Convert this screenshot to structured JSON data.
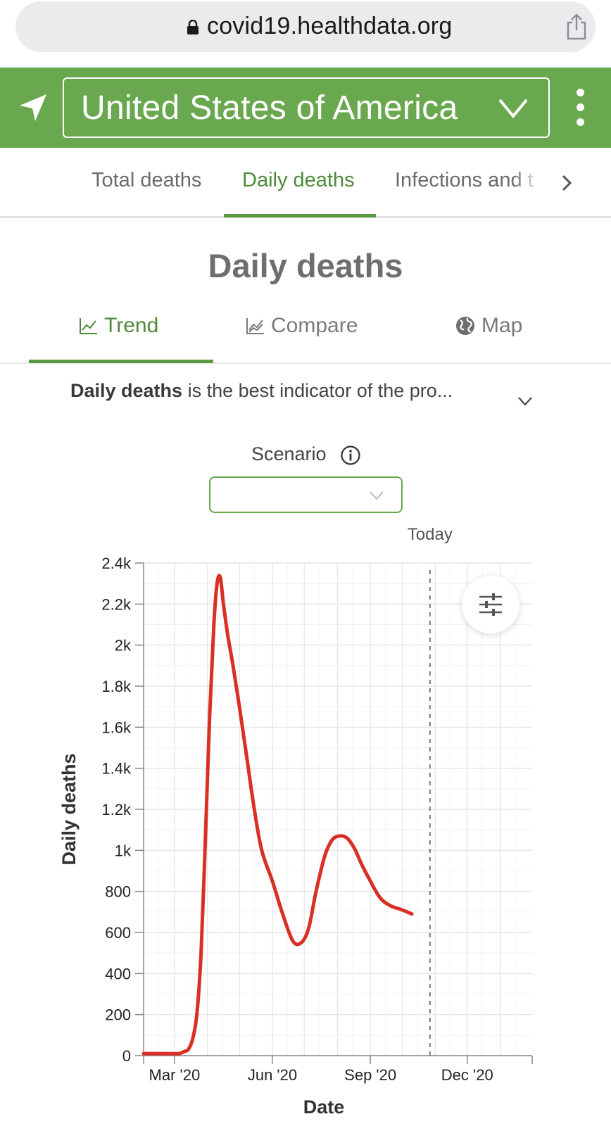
{
  "browser": {
    "url": "covid19.healthdata.org"
  },
  "header": {
    "country": "United States of America"
  },
  "top_tabs": [
    {
      "label": "Total deaths",
      "active": false
    },
    {
      "label": "Daily deaths",
      "active": true
    },
    {
      "label": "Infections and t",
      "active": false
    }
  ],
  "page_title": "Daily deaths",
  "sub_tabs": [
    {
      "label": "Trend",
      "icon": "trend-icon",
      "active": true
    },
    {
      "label": "Compare",
      "icon": "compare-icon",
      "active": false
    },
    {
      "label": "Map",
      "icon": "globe-icon",
      "active": false
    }
  ],
  "description": {
    "bold": "Daily deaths",
    "rest": " is the best indicator of the pro..."
  },
  "scenario": {
    "label": "Scenario",
    "value": ""
  },
  "colors": {
    "brand_green": "#6aa84f",
    "active_tab": "#4f8a3c",
    "line": "#d93025"
  },
  "chart_data": {
    "type": "line",
    "xlabel": "Date",
    "ylabel": "Daily deaths",
    "ylim": [
      0,
      2400
    ],
    "xlim": [
      "2020-02-01",
      "2021-01-31"
    ],
    "grid": true,
    "x_ticks": [
      "2020-03-01",
      "2020-06-01",
      "2020-09-01",
      "2020-12-01"
    ],
    "x_tick_labels": [
      "Mar '20",
      "Jun '20",
      "Sep '20",
      "Dec '20"
    ],
    "y_ticks": [
      0,
      200,
      400,
      600,
      800,
      1000,
      1200,
      1400,
      1600,
      1800,
      2000,
      2200,
      2400
    ],
    "y_tick_labels": [
      "0",
      "200",
      "400",
      "600",
      "800",
      "1k",
      "1.2k",
      "1.4k",
      "1.6k",
      "1.8k",
      "2k",
      "2.2k",
      "2.4k"
    ],
    "today_marker": {
      "label": "Today",
      "date": "2020-10-27"
    },
    "series": [
      {
        "x": [
          "2020-02-01",
          "2020-02-20",
          "2020-03-05",
          "2020-03-10",
          "2020-03-14",
          "2020-03-18",
          "2020-03-22",
          "2020-03-26",
          "2020-03-30",
          "2020-04-03",
          "2020-04-07",
          "2020-04-10",
          "2020-04-13",
          "2020-04-16",
          "2020-04-20",
          "2020-04-25",
          "2020-05-01",
          "2020-05-08",
          "2020-05-15",
          "2020-05-22",
          "2020-06-01",
          "2020-06-10",
          "2020-06-20",
          "2020-06-28",
          "2020-07-05",
          "2020-07-12",
          "2020-07-20",
          "2020-07-27",
          "2020-08-03",
          "2020-08-10",
          "2020-08-17",
          "2020-08-24",
          "2020-08-31",
          "2020-09-10",
          "2020-09-20",
          "2020-10-01",
          "2020-10-10"
        ],
        "values": [
          10,
          10,
          10,
          20,
          30,
          80,
          200,
          500,
          1050,
          1650,
          2100,
          2300,
          2330,
          2200,
          2050,
          1900,
          1700,
          1450,
          1200,
          1000,
          850,
          700,
          560,
          550,
          620,
          800,
          970,
          1050,
          1070,
          1060,
          1010,
          930,
          860,
          770,
          730,
          710,
          690
        ]
      }
    ]
  }
}
